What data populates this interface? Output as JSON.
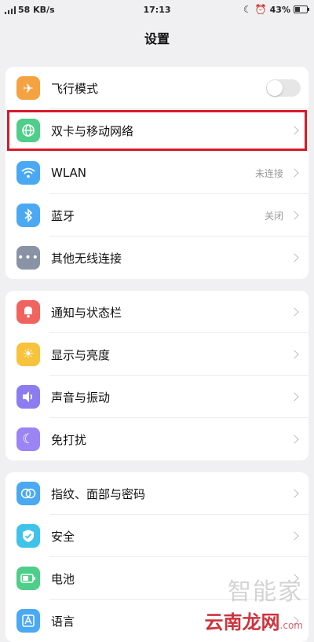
{
  "status_bar": {
    "network_speed": "58 KB/s",
    "time": "17:13",
    "battery": "43%",
    "icons": [
      "signal-icon",
      "moon-icon",
      "alarm-icon",
      "battery-icon"
    ]
  },
  "header": {
    "title": "设置"
  },
  "groups": [
    {
      "items": [
        {
          "label": "飞行模式",
          "icon": "airplane-icon",
          "color": "#f5a242",
          "control": "toggle",
          "toggle_on": false
        },
        {
          "label": "双卡与移动网络",
          "icon": "globe-icon",
          "color": "#4fce8a",
          "control": "chevron",
          "highlighted": true
        },
        {
          "label": "WLAN",
          "icon": "wifi-icon",
          "color": "#4aa9f2",
          "value": "未连接",
          "control": "chevron"
        },
        {
          "label": "蓝牙",
          "icon": "bluetooth-icon",
          "color": "#4aa9f2",
          "value": "关闭",
          "control": "chevron"
        },
        {
          "label": "其他无线连接",
          "icon": "more-dots-icon",
          "color": "#8a93a6",
          "control": "chevron"
        }
      ]
    },
    {
      "items": [
        {
          "label": "通知与状态栏",
          "icon": "bell-icon",
          "color": "#f0635f",
          "control": "chevron"
        },
        {
          "label": "显示与亮度",
          "icon": "brightness-icon",
          "color": "#f7c23c",
          "control": "chevron"
        },
        {
          "label": "声音与振动",
          "icon": "speaker-icon",
          "color": "#8b7cf0",
          "control": "chevron"
        },
        {
          "label": "免打扰",
          "icon": "moon-icon",
          "color": "#9b85f5",
          "control": "chevron"
        }
      ]
    },
    {
      "items": [
        {
          "label": "指纹、面部与密码",
          "icon": "fingerprint-face-icon",
          "color": "#4aa9f2",
          "control": "chevron"
        },
        {
          "label": "安全",
          "icon": "shield-icon",
          "color": "#3fc3e8",
          "control": "chevron"
        },
        {
          "label": "电池",
          "icon": "battery-icon",
          "color": "#4fce8a",
          "control": "chevron"
        },
        {
          "label": "语言",
          "icon": "language-icon",
          "color": "#4aa9f2",
          "control": "chevron"
        }
      ]
    }
  ],
  "watermark": {
    "line1": "智能家",
    "line2": "云南龙网",
    "sub": ".com"
  }
}
